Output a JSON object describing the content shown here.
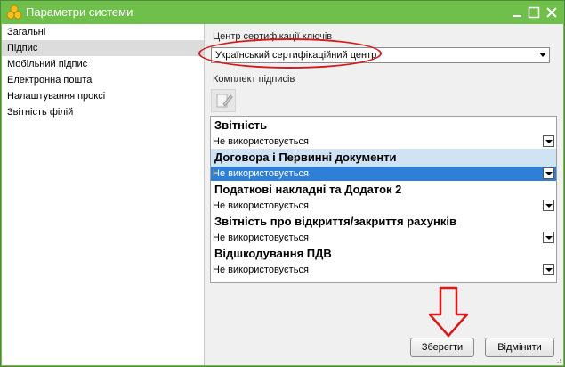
{
  "window": {
    "title": "Параметри системи"
  },
  "nav": {
    "items": [
      {
        "label": "Загальні"
      },
      {
        "label": "Підпис"
      },
      {
        "label": "Мобільний підпис"
      },
      {
        "label": "Електронна пошта"
      },
      {
        "label": "Налаштування проксі"
      },
      {
        "label": "Звітність філій"
      }
    ],
    "selected_index": 1
  },
  "main": {
    "ca_label": "Центр сертифікації ключів",
    "ca_value": "Український сертифікаційний центр",
    "kit_label": "Комплект підписів",
    "groups": [
      {
        "title": "Звітність",
        "value": "Не використовується"
      },
      {
        "title": "Договора і Первинні документи",
        "value": "Не використовується"
      },
      {
        "title": "Податкові накладні та Додаток 2",
        "value": "Не використовується"
      },
      {
        "title": "Звітність про відкриття/закриття рахунків",
        "value": "Не використовується"
      },
      {
        "title": "Відшкодування ПДВ",
        "value": "Не використовується"
      }
    ],
    "selected_group_index": 1
  },
  "buttons": {
    "save": "Зберегти",
    "cancel": "Відмінити"
  },
  "colors": {
    "titlebar": "#6fc04a",
    "annotation": "#d61b1b",
    "selection": "#2f7fd6"
  }
}
